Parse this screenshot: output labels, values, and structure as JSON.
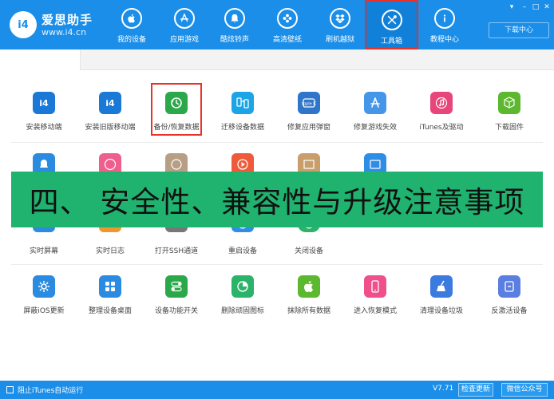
{
  "header": {
    "brand_name": "爱思助手",
    "brand_url": "www.i4.cn",
    "logo_text": "i4",
    "download_center": "下载中心",
    "nav": [
      {
        "label": "我的设备",
        "icon": "apple-icon"
      },
      {
        "label": "应用游戏",
        "icon": "app-store-icon"
      },
      {
        "label": "酷炫铃声",
        "icon": "bell-icon"
      },
      {
        "label": "高清壁纸",
        "icon": "flower-icon"
      },
      {
        "label": "刷机越狱",
        "icon": "dropbox-icon"
      },
      {
        "label": "工具箱",
        "icon": "tools-icon",
        "active": true
      },
      {
        "label": "教程中心",
        "icon": "info-icon"
      }
    ]
  },
  "tools": {
    "row1": [
      {
        "label": "安装移动端",
        "color": "#1a78d6"
      },
      {
        "label": "安装旧版移动端",
        "color": "#1a78d6"
      },
      {
        "label": "备份/恢复数据",
        "color": "#2ba84a"
      },
      {
        "label": "迁移设备数据",
        "color": "#1ba5e8"
      },
      {
        "label": "修复应用弹窗",
        "color": "#2f75c9"
      },
      {
        "label": "修复游戏失效",
        "color": "#4596e8"
      },
      {
        "label": "iTunes及驱动",
        "color": "#e8457a"
      },
      {
        "label": "下载固件",
        "color": "#5cb82e"
      }
    ],
    "row2": [
      {
        "color": "#2a8be0"
      },
      {
        "color": "#ef5f8d"
      },
      {
        "color": "#b79f86"
      },
      {
        "color": "#ef5a3a"
      },
      {
        "color": "#c89f6b"
      },
      {
        "color": "#2e8ee6"
      }
    ],
    "row3": [
      {
        "label": "实时屏幕",
        "color": "#2a8be0"
      },
      {
        "label": "实时日志",
        "color": "#f0962e"
      },
      {
        "label": "打开SSH通道",
        "color": "#777777"
      },
      {
        "label": "重启设备",
        "color": "#2e8ee6"
      },
      {
        "label": "关闭设备",
        "color": "#2bb36a"
      }
    ],
    "row4": [
      {
        "label": "屏蔽iOS更新",
        "color": "#2a8be0"
      },
      {
        "label": "整理设备桌面",
        "color": "#2a8be0"
      },
      {
        "label": "设备功能开关",
        "color": "#2ba84a"
      },
      {
        "label": "删除顽固图标",
        "color": "#2bb36a"
      },
      {
        "label": "抹除所有数据",
        "color": "#5cb82e"
      },
      {
        "label": "进入恢复模式",
        "color": "#ef4f8a"
      },
      {
        "label": "清理设备垃圾",
        "color": "#3b7be0"
      },
      {
        "label": "反激活设备",
        "color": "#5b7fe0"
      }
    ]
  },
  "banner": {
    "text": "四、 安全性、兼容性与升级注意事项"
  },
  "footer": {
    "itunes_label": "阻止iTunes自动运行",
    "version": "V7.71",
    "check_update": "检查更新",
    "wechat": "微信公众号"
  }
}
